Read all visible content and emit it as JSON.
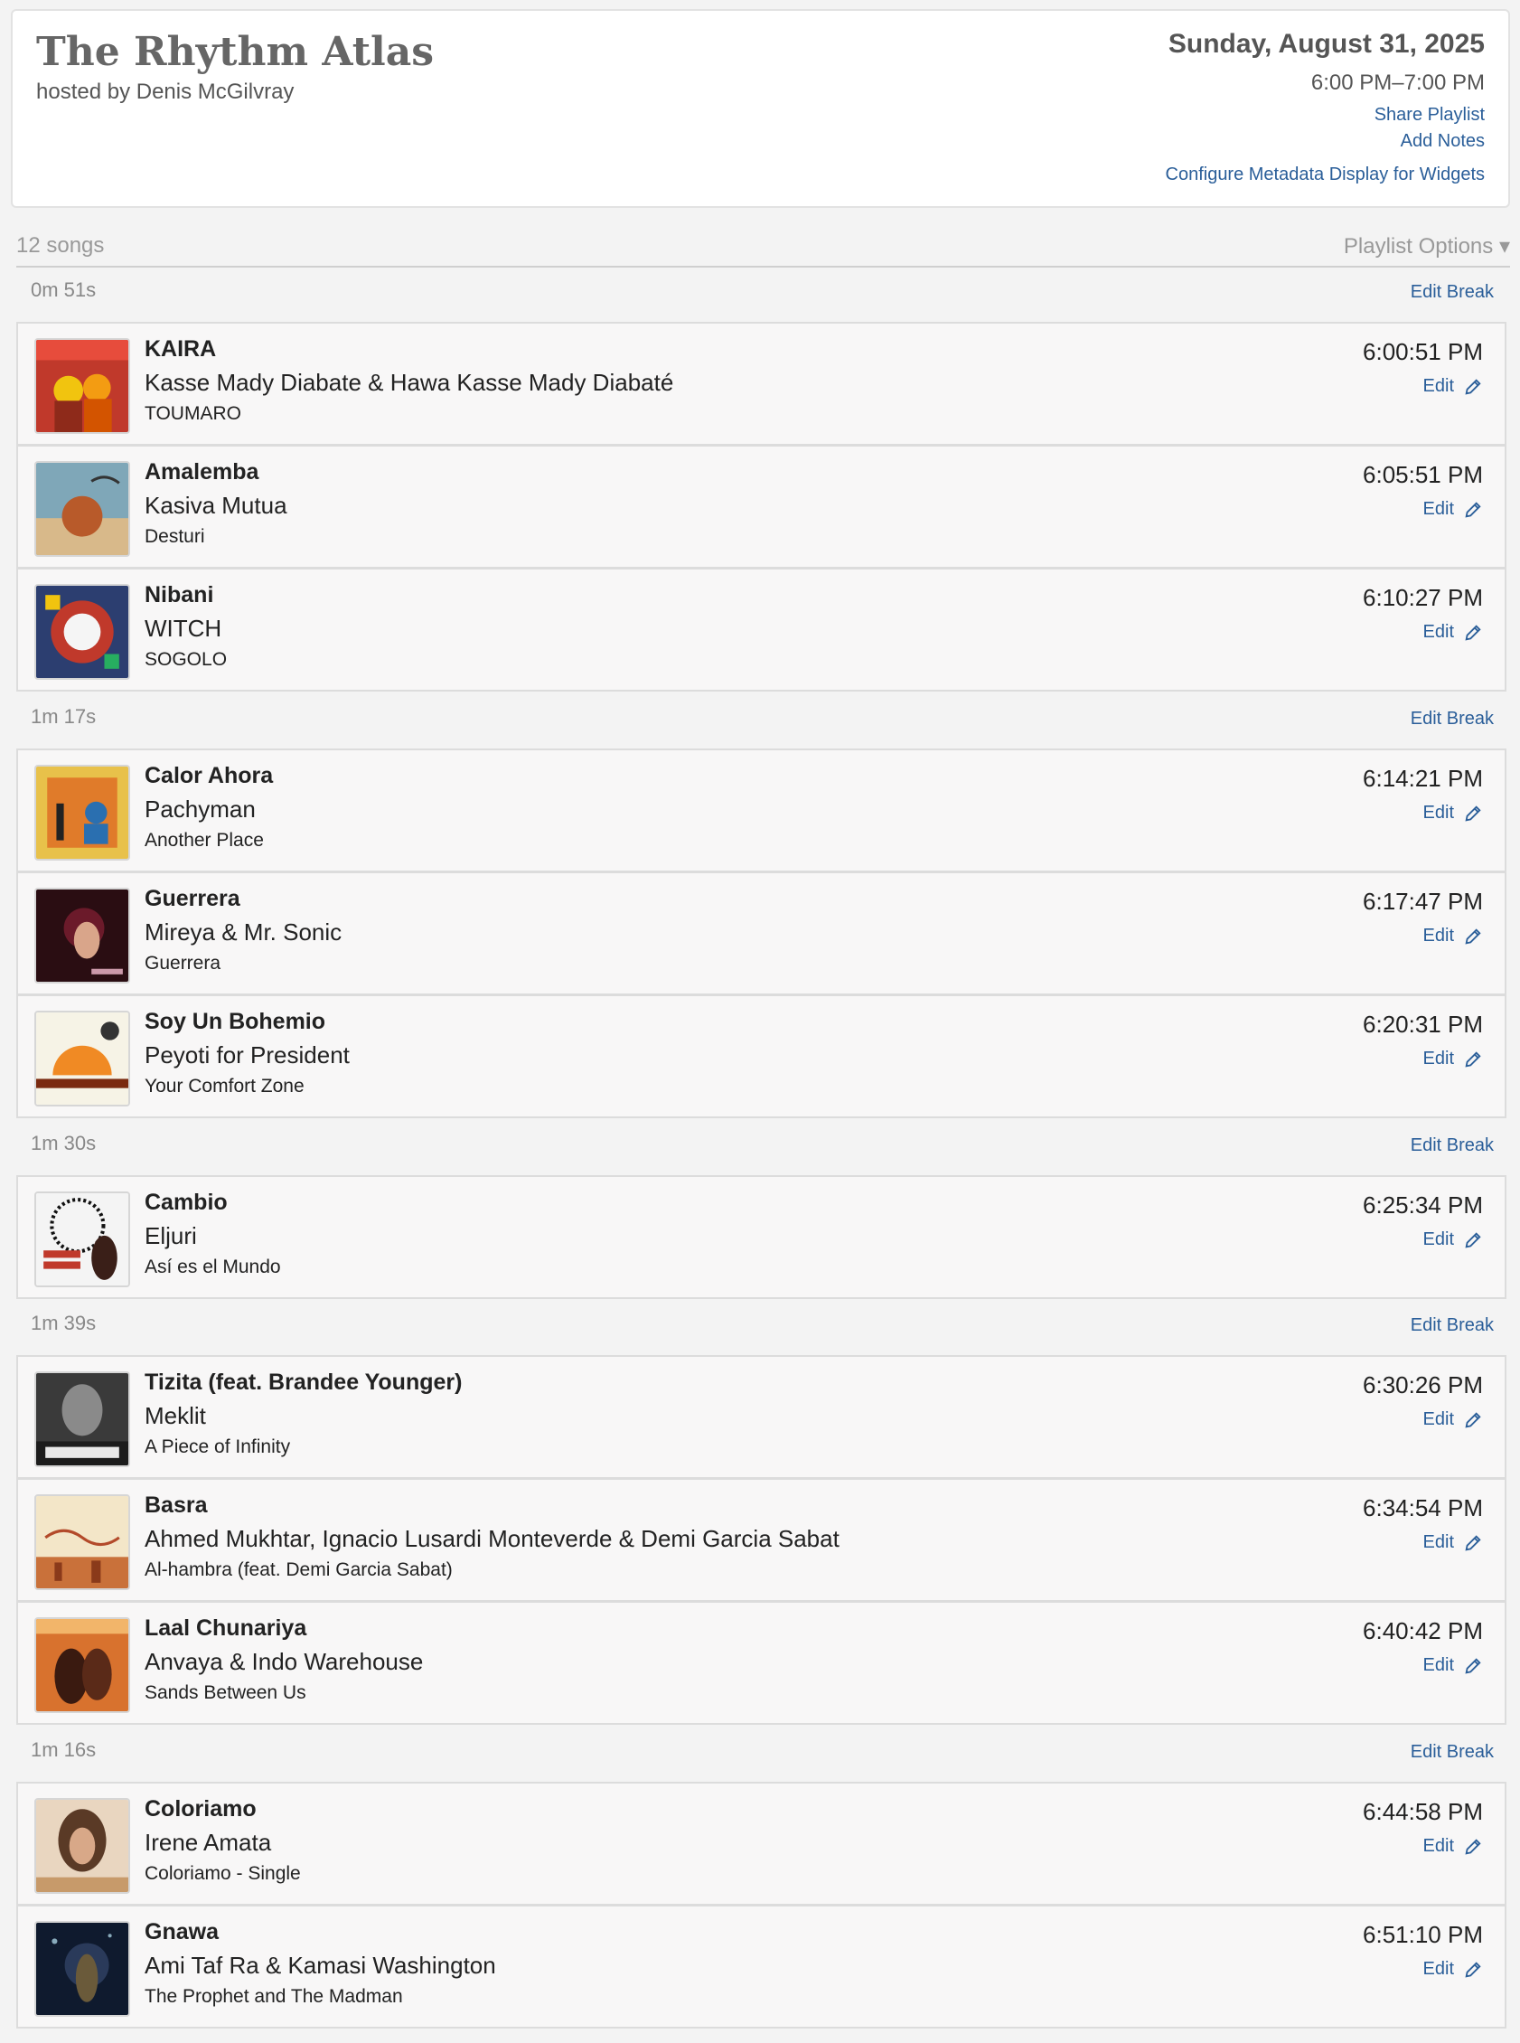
{
  "show": {
    "title": "The Rhythm Atlas",
    "host": "hosted by Denis McGilvray",
    "date": "Sunday, August 31, 2025",
    "time": "6:00 PM–7:00 PM",
    "links": {
      "share": "Share Playlist",
      "notes": "Add Notes",
      "configure": "Configure Metadata Display for Widgets"
    }
  },
  "playlist": {
    "count": "12 songs",
    "options": "Playlist Options ▾"
  },
  "labels": {
    "edit": "Edit",
    "edit_break": "Edit Break"
  },
  "breaks": [
    {
      "duration": "0m 51s"
    },
    {
      "duration": "1m 17s"
    },
    {
      "duration": "1m 30s"
    },
    {
      "duration": "1m 39s"
    },
    {
      "duration": "1m 16s"
    }
  ],
  "songs": [
    {
      "title": "KAIRA",
      "artist": "Kasse Mady Diabate & Hawa Kasse Mady Diabaté",
      "album": "TOUMARO",
      "time": "6:00:51 PM"
    },
    {
      "title": "Amalemba",
      "artist": "Kasiva Mutua",
      "album": "Desturi",
      "time": "6:05:51 PM"
    },
    {
      "title": "Nibani",
      "artist": "WITCH",
      "album": "SOGOLO",
      "time": "6:10:27 PM"
    },
    {
      "title": "Calor Ahora",
      "artist": "Pachyman",
      "album": "Another Place",
      "time": "6:14:21 PM"
    },
    {
      "title": "Guerrera",
      "artist": "Mireya & Mr. Sonic",
      "album": "Guerrera",
      "time": "6:17:47 PM"
    },
    {
      "title": "Soy Un Bohemio",
      "artist": "Peyoti for President",
      "album": "Your Comfort Zone",
      "time": "6:20:31 PM"
    },
    {
      "title": "Cambio",
      "artist": "Eljuri",
      "album": "Así es el Mundo",
      "time": "6:25:34 PM"
    },
    {
      "title": "Tizita (feat. Brandee Younger)",
      "artist": "Meklit",
      "album": "A Piece of Infinity",
      "time": "6:30:26 PM"
    },
    {
      "title": "Basra",
      "artist": "Ahmed Mukhtar, Ignacio Lusardi Monteverde & Demi Garcia Sabat",
      "album": "Al-hambra (feat. Demi Garcia Sabat)",
      "time": "6:34:54 PM"
    },
    {
      "title": "Laal Chunariya",
      "artist": "Anvaya & Indo Warehouse",
      "album": "Sands Between Us",
      "time": "6:40:42 PM"
    },
    {
      "title": "Coloriamo",
      "artist": "Irene Amata",
      "album": "Coloriamo - Single",
      "time": "6:44:58 PM"
    },
    {
      "title": "Gnawa",
      "artist": "Ami Taf Ra & Kamasi Washington",
      "album": "The Prophet and The Madman",
      "time": "6:51:10 PM"
    }
  ]
}
